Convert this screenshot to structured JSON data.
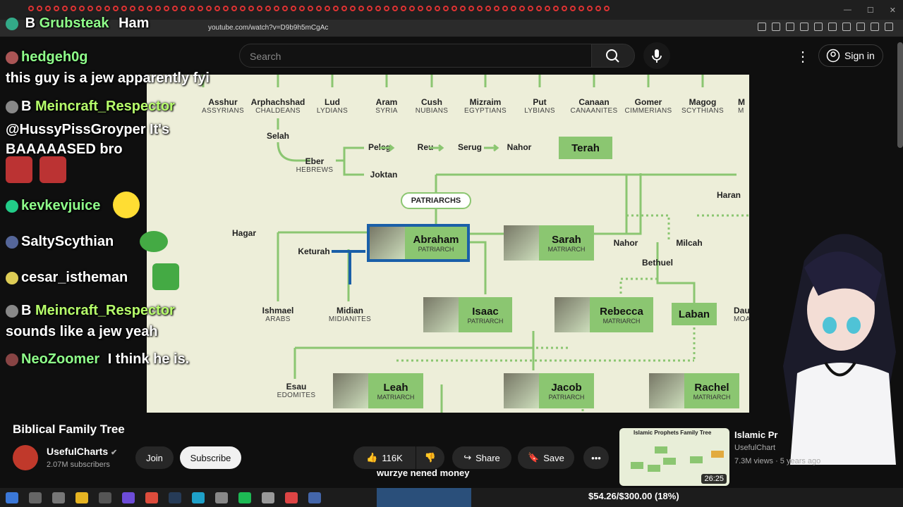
{
  "browser": {
    "url": "youtube.com/watch?v=D9b9h5mCgAc",
    "tab_title": "Ham"
  },
  "header": {
    "search_placeholder": "Search",
    "signin_label": "Sign in"
  },
  "video": {
    "title": "Biblical Family Tree",
    "channel": "UsefulCharts",
    "subscribers": "2.07M subscribers",
    "join_label": "Join",
    "subscribe_label": "Subscribe",
    "likes": "116K",
    "share_label": "Share",
    "save_label": "Save",
    "caption": "wurzye nened money",
    "chart": {
      "top_row": [
        {
          "name": "Asshur",
          "people": "ASSYRIANS"
        },
        {
          "name": "Arphachshad",
          "people": "CHALDEANS"
        },
        {
          "name": "Lud",
          "people": "LYDIANS"
        },
        {
          "name": "Aram",
          "people": "SYRIA"
        },
        {
          "name": "Cush",
          "people": "NUBIANS"
        },
        {
          "name": "Mizraim",
          "people": "EGYPTIANS"
        },
        {
          "name": "Put",
          "people": "LYBIANS"
        },
        {
          "name": "Canaan",
          "people": "CANAANITES"
        },
        {
          "name": "Gomer",
          "people": "CIMMERIANS"
        },
        {
          "name": "Magog",
          "people": "SCYTHIANS"
        },
        {
          "name": "M",
          "people": "M"
        }
      ],
      "selah": "Selah",
      "eber": "Eber",
      "eber_people": "HEBREWS",
      "peleg": "Peleg",
      "reu": "Reu",
      "serug": "Serug",
      "nahor1": "Nahor",
      "terah": "Terah",
      "joktan": "Joktan",
      "haran": "Haran",
      "patriarchs": "PATRIARCHS",
      "hagar": "Hagar",
      "keturah": "Keturah",
      "abraham": "Abraham",
      "abraham_role": "PATRIARCH",
      "sarah": "Sarah",
      "sarah_role": "MATRIARCH",
      "nahor2": "Nahor",
      "milcah": "Milcah",
      "bethuel": "Bethuel",
      "ishmael": "Ishmael",
      "ishmael_people": "ARABS",
      "midian": "Midian",
      "midian_people": "MIDIANITES",
      "isaac": "Isaac",
      "isaac_role": "PATRIARCH",
      "rebecca": "Rebecca",
      "rebecca_role": "MATRIARCH",
      "laban": "Laban",
      "dau": "Dau",
      "dau_people": "MOA",
      "esau": "Esau",
      "esau_people": "EDOMITES",
      "leah": "Leah",
      "leah_role": "MATRIARCH",
      "jacob": "Jacob",
      "jacob_role": "PATRIARCH",
      "rachel": "Rachel",
      "rachel_role": "MATRIARCH"
    }
  },
  "chat": [
    {
      "user": "hedgeh0g",
      "text": "this guy is a jew apparently fyi"
    },
    {
      "user": "Meincraft_Respector",
      "text": "@HussyPissGroyper It's BAAAAASED bro"
    },
    {
      "user": "kevkevjuice",
      "text": ""
    },
    {
      "user": "SaltyScythian",
      "text": ""
    },
    {
      "user": "cesar_istheman",
      "text": ""
    },
    {
      "user": "Meincraft_Respector",
      "text": "sounds like a jew yeah"
    },
    {
      "user": "NeoZoomer",
      "text": "I think he is."
    }
  ],
  "stream_title": "Grubsteak",
  "related": {
    "title": "Islamic Pr",
    "thumb_title": "Islamic Prophets Family Tree",
    "channel": "UsefulChart",
    "meta": "7.3M views · 5 years ago",
    "duration": "26:25"
  },
  "donation": "$54.26/$300.00 (18%)",
  "colors": {
    "chart_bg": "#edeed9",
    "chart_green": "#8bc671",
    "highlight": "#1a5fa8"
  }
}
